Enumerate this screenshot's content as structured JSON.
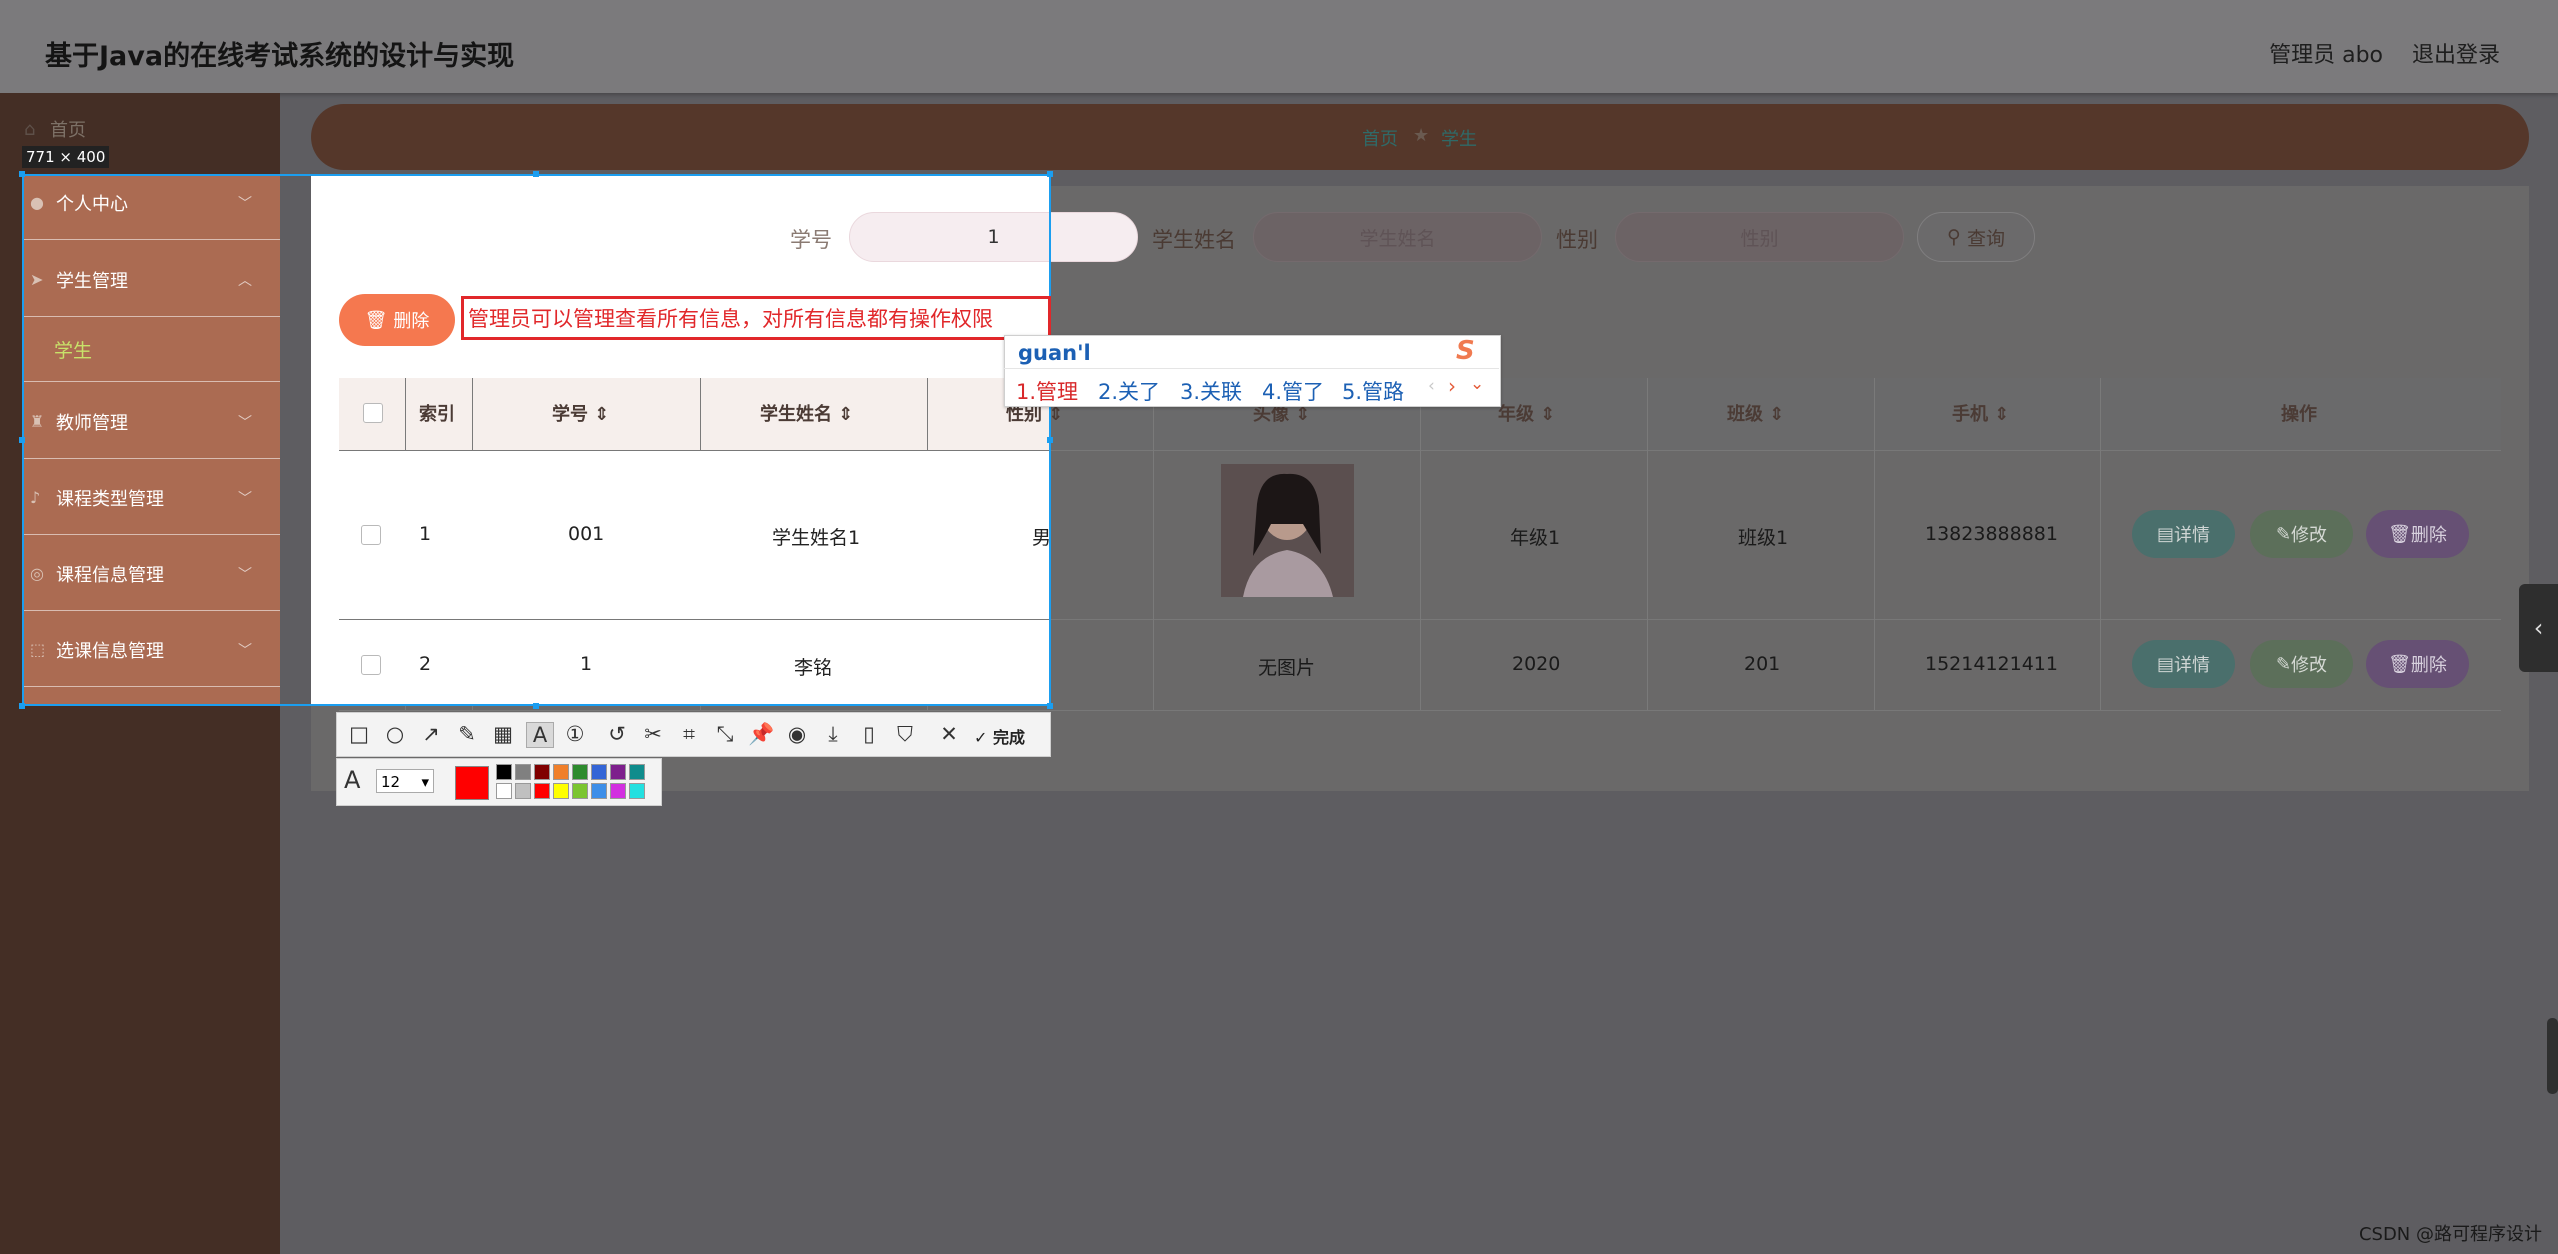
{
  "header": {
    "title": "基于Java的在线考试系统的设计与实现",
    "user": "管理员 abo",
    "logout": "退出登录"
  },
  "sidebar": {
    "home": "首页",
    "items": [
      {
        "label": "个人中心",
        "icon": "user-icon"
      },
      {
        "label": "学生管理",
        "icon": "send-icon"
      },
      {
        "label": "教师管理",
        "icon": "trophy-icon"
      },
      {
        "label": "课程类型管理",
        "icon": "mic-icon"
      },
      {
        "label": "课程信息管理",
        "icon": "globe-icon"
      },
      {
        "label": "选课信息管理",
        "icon": "dashed-box-icon"
      }
    ],
    "sub_active": "学生"
  },
  "breadcrumb": {
    "home": "首页",
    "separator": "★",
    "current": "学生"
  },
  "search": {
    "student_no_label": "学号",
    "student_no_value": "1",
    "student_name_label": "学生姓名",
    "student_name_placeholder": "学生姓名",
    "gender_label": "性别",
    "gender_placeholder": "性别",
    "query_button": "查询"
  },
  "actions": {
    "delete": "删除"
  },
  "table": {
    "headers": [
      "索引",
      "学号",
      "学生姓名",
      "性别",
      "头像",
      "年级",
      "班级",
      "手机",
      "操作"
    ],
    "rows": [
      {
        "index": "1",
        "student_no": "001",
        "name": "学生姓名1",
        "gender": "男",
        "avatar": "",
        "grade": "年级1",
        "class": "班级1",
        "phone": "13823888881"
      },
      {
        "index": "2",
        "student_no": "1",
        "name": "李铭",
        "gender": "",
        "avatar": "无图片",
        "grade": "2020",
        "class": "201",
        "phone": "15214121411"
      }
    ],
    "op_detail": "详情",
    "op_edit": "修改",
    "op_delete": "删除"
  },
  "capture": {
    "size": "771 × 400",
    "annotation": "管理员可以管理查看所有信息，对所有信息都有操作权限",
    "font_size": "12",
    "done": "完成",
    "pen_color": "#ff0000",
    "palette": [
      "#000000",
      "#808080",
      "#800000",
      "#f07f2a",
      "#2e8b2e",
      "#3465d6",
      "#7d1f8c",
      "#0f8c8c",
      "#ffffff",
      "#c0c0c0",
      "#ff0000",
      "#ffff00",
      "#7ac52f",
      "#3d8ee8",
      "#d22fe0",
      "#22e0e0"
    ]
  },
  "ime": {
    "input": "guan'l",
    "candidates": [
      "1.管理",
      "2.关了",
      "3.关联",
      "4.管了",
      "5.管路"
    ]
  },
  "watermark": "CSDN @路可程序设计"
}
